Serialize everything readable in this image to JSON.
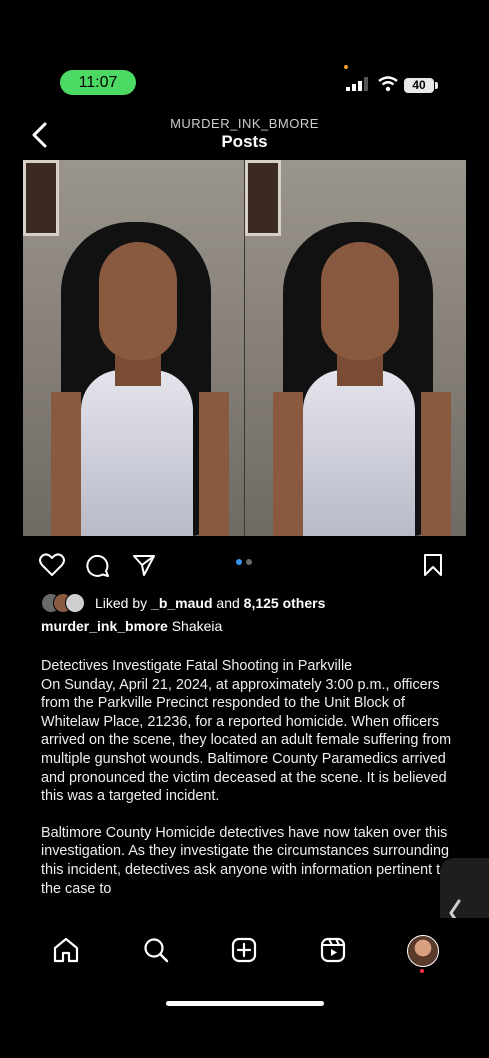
{
  "status": {
    "time": "11:07",
    "battery": "40"
  },
  "header": {
    "account": "MURDER_INK_BMORE",
    "title": "Posts"
  },
  "post": {
    "carousel": {
      "count": 2,
      "active": 1
    },
    "likes": {
      "prefix": "Liked by ",
      "user": "_b_maud",
      "middle": " and ",
      "others": "8,125 others"
    },
    "caption": {
      "username": "murder_ink_bmore",
      "text": " Shakeia"
    },
    "body": [
      "Detectives Investigate Fatal Shooting in Parkville\nOn Sunday, April 21, 2024, at approximately 3:00 p.m., officers from the Parkville Precinct responded to the Unit Block of Whitelaw Place, 21236, for a reported homicide. When officers arrived on the scene, they located an adult female suffering from multiple gunshot wounds. Baltimore County Paramedics arrived and pronounced the victim deceased at the scene. It is believed this was a targeted incident.",
      "Baltimore County Homicide detectives have now taken over this investigation. As they investigate the circumstances surrounding this incident, detectives ask anyone with information pertinent to the case to"
    ]
  },
  "nav": {
    "items": [
      "home-icon",
      "search-icon",
      "create-icon",
      "reels-icon",
      "profile-avatar"
    ]
  },
  "colors": {
    "time_pill": "#4cd964",
    "active_dot": "#3897f0",
    "notification_dot": "#ff3040"
  }
}
